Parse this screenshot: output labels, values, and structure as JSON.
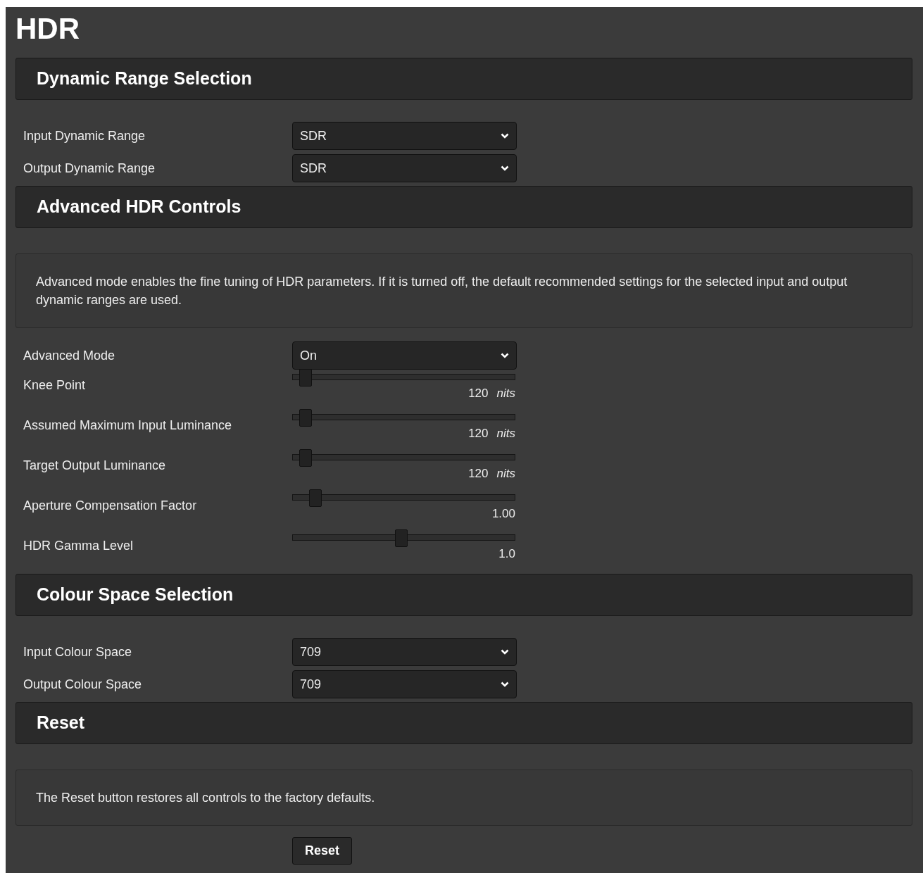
{
  "title": "HDR",
  "sections": [
    {
      "title": "Dynamic Range Selection",
      "items": [
        {
          "kind": "select",
          "label": "Input Dynamic Range",
          "value": "SDR"
        },
        {
          "kind": "select",
          "label": "Output Dynamic Range",
          "value": "SDR"
        }
      ]
    },
    {
      "title": "Advanced HDR Controls",
      "items": [
        {
          "kind": "note",
          "text": "Advanced mode enables the fine tuning of HDR parameters. If it is turned off, the default recommended settings for the selected input and output dynamic ranges are used."
        },
        {
          "kind": "select",
          "label": "Advanced Mode",
          "value": "On"
        },
        {
          "kind": "slider",
          "label": "Knee Point",
          "level": 0.057,
          "reading": "120",
          "unit": "nits"
        },
        {
          "kind": "slider",
          "label": "Assumed Maximum Input Luminance",
          "level": 0.057,
          "reading": "120",
          "unit": "nits"
        },
        {
          "kind": "slider",
          "label": "Target Output Luminance",
          "level": 0.057,
          "reading": "120",
          "unit": "nits"
        },
        {
          "kind": "slider",
          "label": "Aperture Compensation Factor",
          "level": 0.1,
          "reading": "1.00"
        },
        {
          "kind": "slider",
          "label": "HDR Gamma Level",
          "level": 0.49,
          "reading": "1.0"
        }
      ]
    },
    {
      "title": "Colour Space Selection",
      "items": [
        {
          "kind": "select",
          "label": "Input Colour Space",
          "value": "709"
        },
        {
          "kind": "select",
          "label": "Output Colour Space",
          "value": "709"
        }
      ]
    },
    {
      "title": "Reset",
      "items": [
        {
          "kind": "note",
          "text": "The Reset button restores all controls to the factory defaults."
        },
        {
          "kind": "button",
          "label": "Reset"
        }
      ]
    }
  ]
}
